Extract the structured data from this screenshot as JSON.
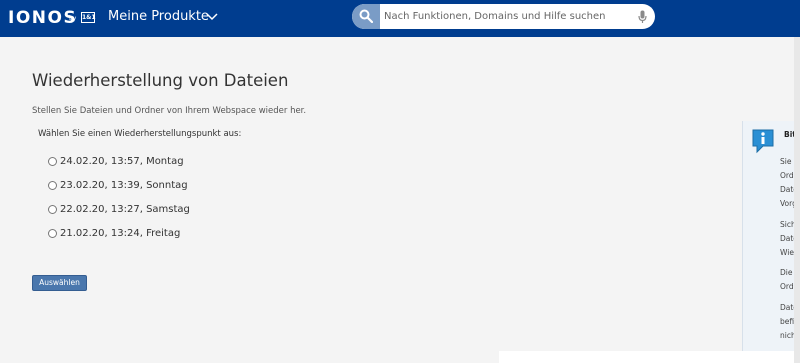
{
  "header": {
    "logo": "IONOS",
    "logo_by": "by",
    "logo_brand": "1&1",
    "products_label": "Meine Produkte",
    "search_placeholder": "Nach Funktionen, Domains und Hilfe suchen"
  },
  "main": {
    "title": "Wiederherstellung von Dateien",
    "subtitle": "Stellen Sie Dateien und Ordner von Ihrem Webspace wieder her.",
    "prompt": "Wählen Sie einen Wiederherstellungspunkt aus:",
    "restore_points": [
      {
        "label": "24.02.20, 13:57, Montag",
        "selected": false
      },
      {
        "label": "23.02.20, 13:39, Sonntag",
        "selected": false
      },
      {
        "label": "22.02.20, 13:27, Samstag",
        "selected": false
      },
      {
        "label": "21.02.20, 13:24, Freitag",
        "selected": false
      }
    ],
    "select_button": "Auswählen"
  },
  "info_box": {
    "title": "Bitte",
    "paragraphs": [
      [
        "Sie fi",
        "Ordn",
        "Date",
        "Vorg"
      ],
      [
        "Siche",
        "Date",
        "Wied"
      ],
      [
        "Die W",
        "Ordn"
      ],
      [
        "Date",
        "befin",
        "nicht"
      ]
    ]
  },
  "colors": {
    "header_bg": "#003d8f",
    "page_bg": "#f4f4f4",
    "button_bg": "#4a77ad",
    "search_button_bg": "#7a9cc6",
    "info_bg": "#eef3f8"
  },
  "icons": {
    "search": "search-icon",
    "microphone": "microphone-icon",
    "chevron": "chevron-down-icon",
    "info": "info-speech-bubble-icon"
  }
}
